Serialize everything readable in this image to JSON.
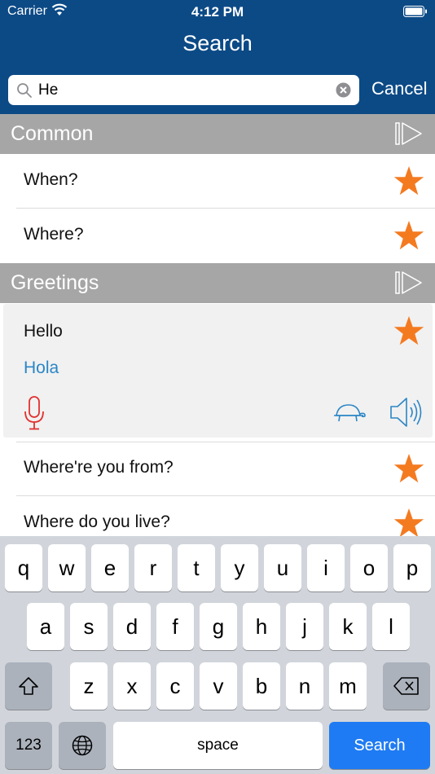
{
  "status_bar": {
    "carrier": "Carrier",
    "time": "4:12 PM"
  },
  "nav": {
    "title": "Search"
  },
  "search": {
    "value": "He",
    "cancel_label": "Cancel"
  },
  "sections": [
    {
      "title": "Common",
      "items": [
        {
          "label": "When?"
        },
        {
          "label": "Where?"
        }
      ]
    },
    {
      "title": "Greetings",
      "expanded_item": {
        "label": "Hello",
        "translation": "Hola"
      },
      "items": [
        {
          "label": "Where're you from?"
        },
        {
          "label": "Where do you live?"
        }
      ]
    }
  ],
  "keyboard": {
    "row1": [
      "q",
      "w",
      "e",
      "r",
      "t",
      "y",
      "u",
      "i",
      "o",
      "p"
    ],
    "row2": [
      "a",
      "s",
      "d",
      "f",
      "g",
      "h",
      "j",
      "k",
      "l"
    ],
    "row3": [
      "z",
      "x",
      "c",
      "v",
      "b",
      "n",
      "m"
    ],
    "numbers_label": "123",
    "space_label": "space",
    "search_label": "Search"
  },
  "icons": [
    "wifi-icon",
    "battery-icon",
    "search-icon",
    "clear-icon",
    "play-icon",
    "star-icon",
    "mic-icon",
    "turtle-icon",
    "speaker-icon",
    "shift-icon",
    "backspace-icon",
    "globe-icon"
  ],
  "colors": {
    "nav": "#0c4a86",
    "section": "#a6a6a6",
    "star": "#f47a20",
    "translation": "#2a86c6",
    "mic": "#e0312f",
    "search_key": "#1f7bf3",
    "keyboard": "#d1d5db"
  }
}
